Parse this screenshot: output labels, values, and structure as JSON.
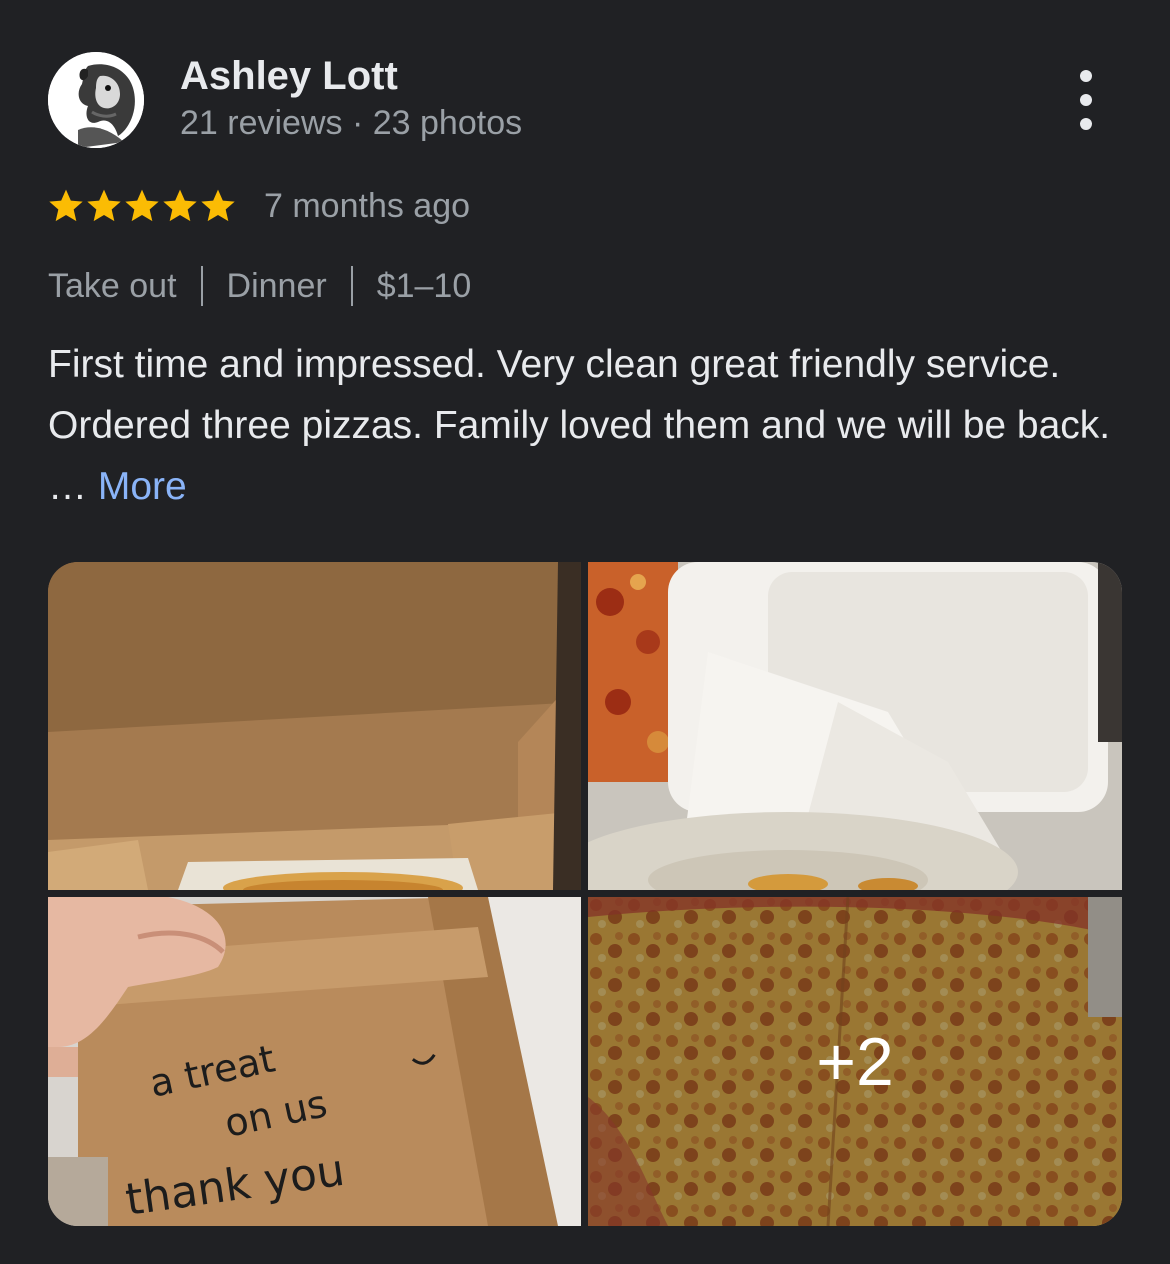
{
  "review": {
    "author": {
      "name": "Ashley Lott",
      "reviews_count": "21 reviews",
      "meta_separator": "·",
      "photos_count": "23 photos"
    },
    "rating": 5,
    "rating_max": 5,
    "time": "7 months ago",
    "attributes": [
      "Take out",
      "Dinner",
      "$1–10"
    ],
    "text": "First time and impressed. Very clean great friendly service. Ordered three pizzas. Family loved them and we will be back. …",
    "more_label": "More",
    "photos": {
      "items": [
        "pizza-box-photo",
        "takeout-container-photo",
        "paper-bag-photo",
        "cheese-pizza-photo"
      ],
      "more_count": "+2",
      "bag_note": [
        "a treat",
        "on us",
        "thank you"
      ]
    }
  },
  "colors": {
    "background": "#202124",
    "primary_text": "#e8eaed",
    "secondary_text": "#9aa0a6",
    "star": "#fbbc04",
    "link": "#8ab4f8"
  },
  "icons": {
    "menu": "more-vert-icon",
    "star": "star-icon"
  }
}
